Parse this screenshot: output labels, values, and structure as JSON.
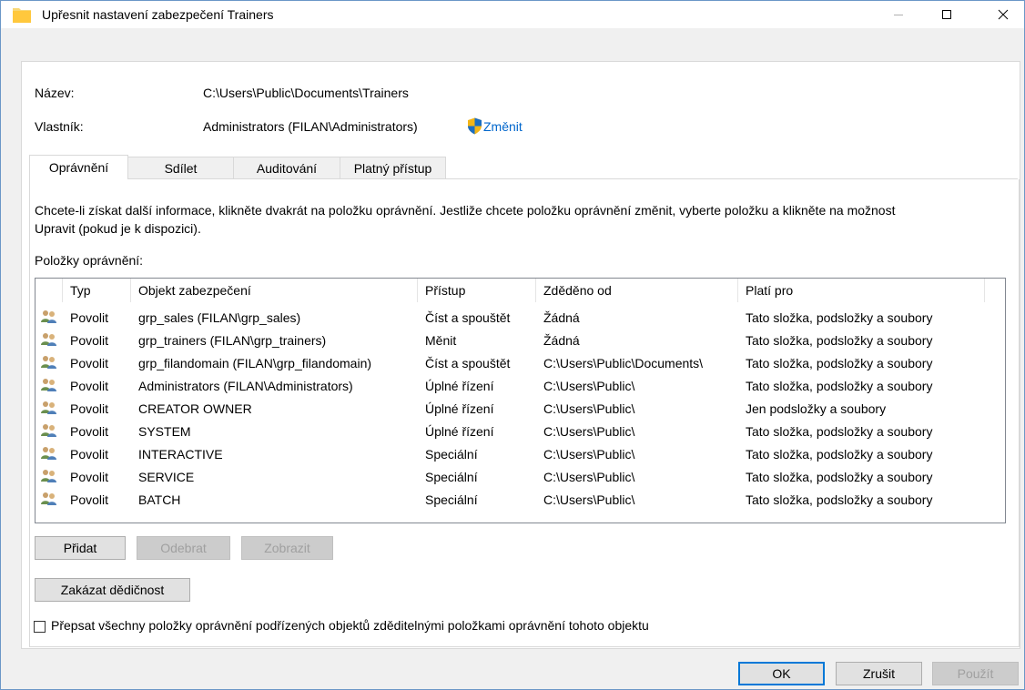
{
  "window": {
    "title": "Upřesnit nastavení zabezpečení Trainers",
    "minimize_label": "—",
    "maximize_label": "☐",
    "close_label": "✕"
  },
  "info": {
    "name_label": "Název:",
    "name_value": "C:\\Users\\Public\\Documents\\Trainers",
    "owner_label": "Vlastník:",
    "owner_value": "Administrators (FILAN\\Administrators)",
    "change_link": "Změnit"
  },
  "tabs": [
    {
      "label": "Oprávnění",
      "active": true
    },
    {
      "label": "Sdílet",
      "active": false
    },
    {
      "label": "Auditování",
      "active": false
    },
    {
      "label": "Platný přístup",
      "active": false
    }
  ],
  "description": {
    "line1": "Chcete-li získat další informace, klikněte dvakrát na položku oprávnění. Jestliže chcete položku oprávnění změnit, vyberte položku a klikněte na možnost",
    "line2": "Upravit (pokud je k dispozici)."
  },
  "list_label": "Položky oprávnění:",
  "columns": {
    "type": "Typ",
    "principal": "Objekt zabezpečení",
    "access": "Přístup",
    "inherited": "Zděděno od",
    "applies": "Platí pro"
  },
  "rows": [
    {
      "icon": "users-icon",
      "type": "Povolit",
      "principal": "grp_sales (FILAN\\grp_sales)",
      "access": "Číst a spouštět",
      "inherited": "Žádná",
      "applies": "Tato složka, podsložky a soubory"
    },
    {
      "icon": "users-icon",
      "type": "Povolit",
      "principal": "grp_trainers (FILAN\\grp_trainers)",
      "access": "Měnit",
      "inherited": "Žádná",
      "applies": "Tato složka, podsložky a soubory"
    },
    {
      "icon": "users-icon",
      "type": "Povolit",
      "principal": "grp_filandomain (FILAN\\grp_filandomain)",
      "access": "Číst a spouštět",
      "inherited": "C:\\Users\\Public\\Documents\\",
      "applies": "Tato složka, podsložky a soubory"
    },
    {
      "icon": "users-icon",
      "type": "Povolit",
      "principal": "Administrators (FILAN\\Administrators)",
      "access": "Úplné řízení",
      "inherited": "C:\\Users\\Public\\",
      "applies": "Tato složka, podsložky a soubory"
    },
    {
      "icon": "users-icon",
      "type": "Povolit",
      "principal": "CREATOR OWNER",
      "access": "Úplné řízení",
      "inherited": "C:\\Users\\Public\\",
      "applies": "Jen podsložky a soubory"
    },
    {
      "icon": "users-icon",
      "type": "Povolit",
      "principal": "SYSTEM",
      "access": "Úplné řízení",
      "inherited": "C:\\Users\\Public\\",
      "applies": "Tato složka, podsložky a soubory"
    },
    {
      "icon": "users-icon",
      "type": "Povolit",
      "principal": "INTERACTIVE",
      "access": "Speciální",
      "inherited": "C:\\Users\\Public\\",
      "applies": "Tato složka, podsložky a soubory"
    },
    {
      "icon": "users-icon",
      "type": "Povolit",
      "principal": "SERVICE",
      "access": "Speciální",
      "inherited": "C:\\Users\\Public\\",
      "applies": "Tato složka, podsložky a soubory"
    },
    {
      "icon": "users-icon",
      "type": "Povolit",
      "principal": "BATCH",
      "access": "Speciální",
      "inherited": "C:\\Users\\Public\\",
      "applies": "Tato složka, podsložky a soubory"
    }
  ],
  "buttons": {
    "add": "Přidat",
    "remove": "Odebrat",
    "view": "Zobrazit",
    "disable_inheritance": "Zakázat dědičnost",
    "ok": "OK",
    "cancel": "Zrušit",
    "apply": "Použít"
  },
  "replace_checkbox": {
    "label": "Přepsat všechny položky oprávnění podřízených objektů zděditelnými položkami oprávnění tohoto objektu",
    "checked": false
  }
}
